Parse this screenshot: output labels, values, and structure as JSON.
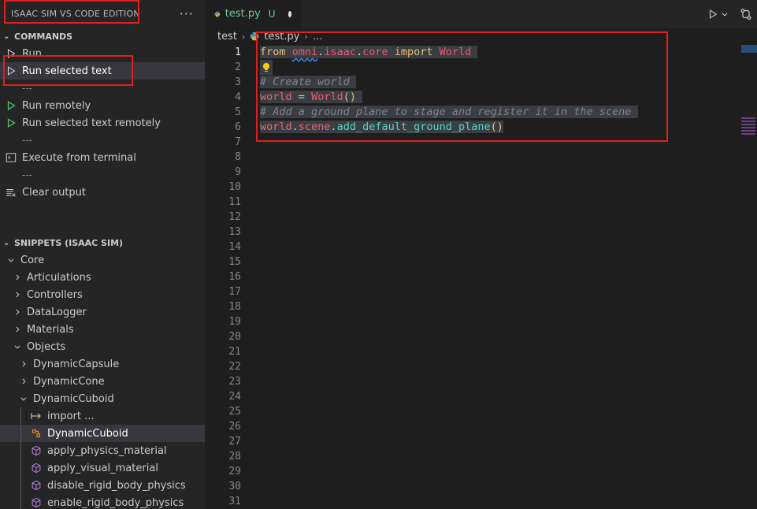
{
  "sidebar": {
    "title": "ISAAC SIM VS CODE EDITION",
    "more": "···",
    "commands_title": "COMMANDS",
    "commands": [
      {
        "type": "cmd",
        "label": "Run",
        "icon": "play-outline-icon"
      },
      {
        "type": "cmd",
        "label": "Run selected text",
        "icon": "play-outline-icon",
        "selected": true
      },
      {
        "type": "sep",
        "label": "---"
      },
      {
        "type": "cmd",
        "label": "Run remotely",
        "icon": "play-green-icon"
      },
      {
        "type": "cmd",
        "label": "Run selected text remotely",
        "icon": "play-green-icon"
      },
      {
        "type": "sep",
        "label": "---"
      },
      {
        "type": "cmd",
        "label": "Execute from terminal",
        "icon": "terminal-icon"
      },
      {
        "type": "sep",
        "label": "---"
      },
      {
        "type": "cmd",
        "label": "Clear output",
        "icon": "clear-all-icon"
      }
    ],
    "snippets_title": "SNIPPETS (ISAAC SIM)",
    "snippets": [
      {
        "label": "Core",
        "level": 0,
        "chevron": "down"
      },
      {
        "label": "Articulations",
        "level": 1,
        "chevron": "right"
      },
      {
        "label": "Controllers",
        "level": 1,
        "chevron": "right"
      },
      {
        "label": "DataLogger",
        "level": 1,
        "chevron": "right"
      },
      {
        "label": "Materials",
        "level": 1,
        "chevron": "right"
      },
      {
        "label": "Objects",
        "level": 1,
        "chevron": "down"
      },
      {
        "label": "DynamicCapsule",
        "level": 2,
        "chevron": "right"
      },
      {
        "label": "DynamicCone",
        "level": 2,
        "chevron": "right"
      },
      {
        "label": "DynamicCuboid",
        "level": 2,
        "chevron": "down"
      },
      {
        "label": "import ...",
        "level": 3,
        "icon": "import-arrow-icon"
      },
      {
        "label": "DynamicCuboid",
        "level": 3,
        "icon": "class-icon",
        "selected": true
      },
      {
        "label": "apply_physics_material",
        "level": 3,
        "icon": "method-cube-icon"
      },
      {
        "label": "apply_visual_material",
        "level": 3,
        "icon": "method-cube-icon"
      },
      {
        "label": "disable_rigid_body_physics",
        "level": 3,
        "icon": "method-cube-icon"
      },
      {
        "label": "enable_rigid_body_physics",
        "level": 3,
        "icon": "method-cube-icon"
      }
    ]
  },
  "editor": {
    "tab_name": "test.py",
    "tab_status": "U",
    "breadcrumb": [
      "test",
      "test.py",
      "..."
    ],
    "line_count": 31,
    "active_line": 1
  },
  "code": {
    "l1_from": "from",
    "l1_omni": "omni",
    "l1_isaac": "isaac",
    "l1_core": "core",
    "l1_import": "import",
    "l1_world": "World",
    "l3_comment": "# Create world",
    "l4_var": "world",
    "l4_eq": "=",
    "l4_cls": "World",
    "l4_parens": "()",
    "l5_comment": "# Add a ground plane to stage and register it in the scene",
    "l6_world": "world",
    "l6_scene": "scene",
    "l6_fn": "add_default_ground_plane",
    "l6_parens": "()"
  }
}
